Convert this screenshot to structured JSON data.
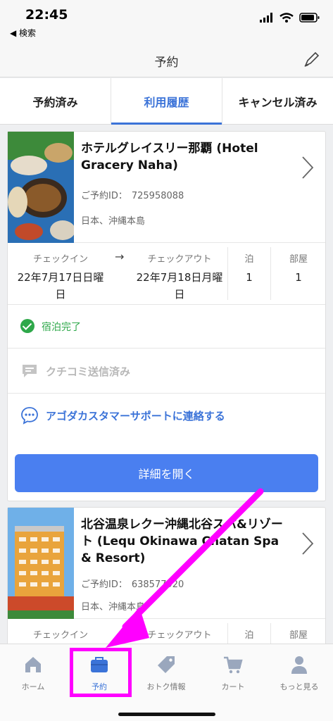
{
  "status_bar": {
    "time": "22:45",
    "back_label": "◀ 検索"
  },
  "nav": {
    "title": "予約"
  },
  "tabs": [
    {
      "label": "予約済み"
    },
    {
      "label": "利用履歴"
    },
    {
      "label": "キャンセル済み"
    }
  ],
  "bookings": [
    {
      "hotel_name": "ホテルグレイスリー那覇 (Hotel Gracery Naha)",
      "booking_id_label": "ご予約ID：",
      "booking_id": "725958088",
      "location": "日本、沖縄本島",
      "checkin_label": "チェックイン",
      "checkin_date": "22年7月17日日曜日",
      "checkout_label": "チェックアウト",
      "checkout_date": "22年7月18日月曜日",
      "nights_label": "泊",
      "nights": "1",
      "rooms_label": "部屋",
      "rooms": "1",
      "status": "宿泊完了",
      "review_status": "クチコミ送信済み",
      "support_link": "アゴダカスタマーサポートに連絡する",
      "open_button": "詳細を開く"
    },
    {
      "hotel_name": "北谷温泉レクー沖縄北谷スパ&リゾート (Lequ Okinawa Chatan Spa & Resort)",
      "booking_id_label": "ご予約ID：",
      "booking_id": "638577920",
      "location": "日本、沖縄本島",
      "checkin_label": "チェックイン",
      "checkout_label": "チェックアウト",
      "nights_label": "泊",
      "rooms_label": "部屋"
    }
  ],
  "bottom_nav": [
    {
      "label": "ホーム",
      "icon": "home-icon"
    },
    {
      "label": "予約",
      "icon": "suitcase-icon"
    },
    {
      "label": "おトク情報",
      "icon": "tag-icon"
    },
    {
      "label": "カート",
      "icon": "cart-icon"
    },
    {
      "label": "もっと見る",
      "icon": "user-icon"
    }
  ],
  "colors": {
    "accent": "#3b73d8",
    "button": "#4a7ff0",
    "success": "#2ea84a",
    "annotation": "#ff00ff"
  }
}
